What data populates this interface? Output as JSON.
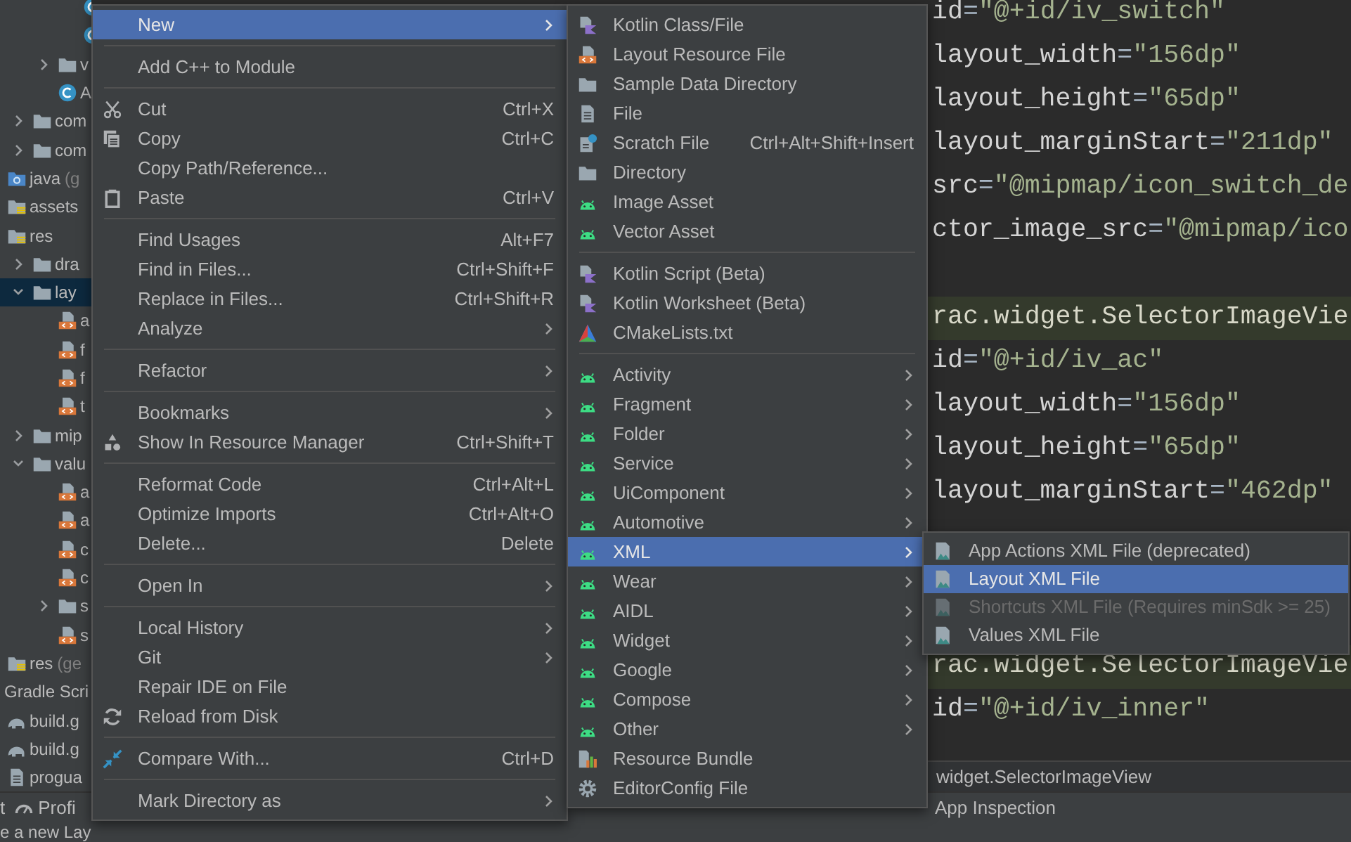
{
  "project_tree": [
    {
      "children": [
        {
          "children": [
            {
              "children": [
                {
                  "children": [
                    {
                      "kind": "class",
                      "selected": false
                    },
                    {
                      "kind": "class",
                      "selected": false
                    }
                  ]
                },
                {
                  "label": "v",
                  "kind": "folder",
                  "expanded": false,
                  "selected": false
                },
                {
                  "label": "A",
                  "kind": "class",
                  "selected": false
                }
              ]
            },
            {
              "label": "com",
              "kind": "folder",
              "expanded": false,
              "selected": false
            },
            {
              "label": "com",
              "kind": "folder",
              "expanded": false,
              "selected": false
            }
          ]
        },
        {
          "label": "java",
          "hint": "(g",
          "kind": "sourceroot",
          "selected": false
        },
        {
          "label": "assets",
          "kind": "resourceroot",
          "selected": false
        },
        {
          "label": "res",
          "kind": "resourceroot",
          "selected": false,
          "children": [
            {
              "label": "dra",
              "kind": "folder",
              "expanded": false,
              "selected": false
            },
            {
              "label": "lay",
              "kind": "folder",
              "expanded": true,
              "selected": true,
              "children": [
                {
                  "label": "a",
                  "kind": "layout",
                  "selected": false
                },
                {
                  "label": "f",
                  "kind": "layout",
                  "selected": false
                },
                {
                  "label": "f",
                  "kind": "layout",
                  "selected": false
                },
                {
                  "label": "t",
                  "kind": "layout",
                  "selected": false
                }
              ]
            },
            {
              "label": "mip",
              "kind": "folder",
              "expanded": false,
              "selected": false
            },
            {
              "label": "valu",
              "kind": "folder",
              "expanded": true,
              "selected": false,
              "children": [
                {
                  "label": "a",
                  "kind": "layout",
                  "selected": false
                },
                {
                  "label": "a",
                  "kind": "layout",
                  "selected": false
                },
                {
                  "label": "c",
                  "kind": "layout",
                  "selected": false
                },
                {
                  "label": "c",
                  "kind": "layout",
                  "selected": false
                },
                {
                  "label": "s",
                  "kind": "folder",
                  "expanded": false,
                  "selected": false
                },
                {
                  "label": "s",
                  "kind": "layout",
                  "selected": false
                }
              ]
            }
          ]
        },
        {
          "label": "res",
          "hint": "(ge",
          "kind": "resourceroot",
          "selected": false
        }
      ]
    },
    {
      "label": "Gradle Scri",
      "kind": "gradle",
      "selected": false,
      "children": [
        {
          "label": "build.g",
          "kind": "gradle",
          "selected": false
        },
        {
          "label": "build.g",
          "kind": "gradle",
          "selected": false
        },
        {
          "label": "progua",
          "kind": "file",
          "selected": false
        }
      ]
    }
  ],
  "code_lines": [
    {
      "kind": "code",
      "highlighted": false,
      "parts": [
        {
          "kind": "name",
          "text": "id"
        },
        {
          "kind": "punct",
          "text": "="
        },
        {
          "kind": "value",
          "text": "\"@+id/iv_switch\""
        }
      ]
    },
    {
      "kind": "code",
      "highlighted": false,
      "parts": [
        {
          "kind": "name",
          "text": "layout_width"
        },
        {
          "kind": "punct",
          "text": "="
        },
        {
          "kind": "value",
          "text": "\"156dp\""
        }
      ]
    },
    {
      "kind": "code",
      "highlighted": false,
      "parts": [
        {
          "kind": "name",
          "text": "layout_height"
        },
        {
          "kind": "punct",
          "text": "="
        },
        {
          "kind": "value",
          "text": "\"65dp\""
        }
      ]
    },
    {
      "kind": "code",
      "highlighted": false,
      "parts": [
        {
          "kind": "name",
          "text": "layout_marginStart"
        },
        {
          "kind": "punct",
          "text": "="
        },
        {
          "kind": "value",
          "text": "\"211dp\""
        }
      ]
    },
    {
      "kind": "code",
      "highlighted": false,
      "parts": [
        {
          "kind": "name",
          "text": "src"
        },
        {
          "kind": "punct",
          "text": "="
        },
        {
          "kind": "value",
          "text": "\"@mipmap/icon_switch_de"
        }
      ]
    },
    {
      "kind": "code",
      "highlighted": false,
      "parts": [
        {
          "kind": "name",
          "text": "ctor_image_src"
        },
        {
          "kind": "punct",
          "text": "="
        },
        {
          "kind": "value",
          "text": "\"@mipmap/ico"
        }
      ]
    },
    {
      "kind": "blank"
    },
    {
      "kind": "code",
      "highlighted": true,
      "parts": [
        {
          "kind": "tag",
          "text": "rac.widget.SelectorImageVie"
        }
      ]
    },
    {
      "kind": "code",
      "highlighted": false,
      "parts": [
        {
          "kind": "name",
          "text": "id"
        },
        {
          "kind": "punct",
          "text": "="
        },
        {
          "kind": "value",
          "text": "\"@+id/iv_ac\""
        }
      ]
    },
    {
      "kind": "code",
      "highlighted": false,
      "parts": [
        {
          "kind": "name",
          "text": "layout_width"
        },
        {
          "kind": "punct",
          "text": "="
        },
        {
          "kind": "value",
          "text": "\"156dp\""
        }
      ]
    },
    {
      "kind": "code",
      "highlighted": false,
      "parts": [
        {
          "kind": "name",
          "text": "layout_height"
        },
        {
          "kind": "punct",
          "text": "="
        },
        {
          "kind": "value",
          "text": "\"65dp\""
        }
      ]
    },
    {
      "kind": "code",
      "highlighted": false,
      "parts": [
        {
          "kind": "name",
          "text": "layout_marginStart"
        },
        {
          "kind": "punct",
          "text": "="
        },
        {
          "kind": "value",
          "text": "\"462dp\""
        }
      ]
    },
    {
      "kind": "blank"
    },
    {
      "kind": "blank"
    },
    {
      "kind": "blank"
    },
    {
      "kind": "code",
      "highlighted": true,
      "parts": [
        {
          "kind": "tag",
          "text": "rac.widget.SelectorImageVie"
        }
      ]
    },
    {
      "kind": "code",
      "highlighted": false,
      "parts": [
        {
          "kind": "name",
          "text": "id"
        },
        {
          "kind": "punct",
          "text": "="
        },
        {
          "kind": "value",
          "text": "\"@+id/iv_inner\""
        }
      ]
    }
  ],
  "breadcrumb": "widget.SelectorImageView",
  "bottom_bar": {
    "left": [
      {
        "label": "t",
        "kind": "plain"
      },
      {
        "label": "Profi",
        "kind": "profiler"
      }
    ],
    "right": [
      {
        "label": "App Inspection"
      }
    ]
  },
  "status_bar": "e a new Lay",
  "context_menu": {
    "items": [
      {
        "kind": "plain",
        "label": "New",
        "selected": true,
        "submenu": true
      },
      {
        "kind": "separator"
      },
      {
        "kind": "plain",
        "label": "Add C++ to Module",
        "selected": false,
        "submenu": false
      },
      {
        "kind": "separator"
      },
      {
        "kind": "scissors",
        "label": "Cut",
        "shortcut": "Ctrl+X",
        "selected": false,
        "submenu": false
      },
      {
        "kind": "copy",
        "label": "Copy",
        "shortcut": "Ctrl+C",
        "selected": false,
        "submenu": false
      },
      {
        "kind": "plain",
        "label": "Copy Path/Reference...",
        "selected": false,
        "submenu": false
      },
      {
        "kind": "paste",
        "label": "Paste",
        "shortcut": "Ctrl+V",
        "selected": false,
        "submenu": false
      },
      {
        "kind": "separator"
      },
      {
        "kind": "plain",
        "label": "Find Usages",
        "shortcut": "Alt+F7",
        "selected": false,
        "submenu": false
      },
      {
        "kind": "plain",
        "label": "Find in Files...",
        "shortcut": "Ctrl+Shift+F",
        "selected": false,
        "submenu": false
      },
      {
        "kind": "plain",
        "label": "Replace in Files...",
        "shortcut": "Ctrl+Shift+R",
        "selected": false,
        "submenu": false
      },
      {
        "kind": "plain",
        "label": "Analyze",
        "selected": false,
        "submenu": true
      },
      {
        "kind": "separator"
      },
      {
        "kind": "plain",
        "label": "Refactor",
        "selected": false,
        "submenu": true
      },
      {
        "kind": "separator"
      },
      {
        "kind": "plain",
        "label": "Bookmarks",
        "selected": false,
        "submenu": true
      },
      {
        "kind": "resources",
        "label": "Show In Resource Manager",
        "shortcut": "Ctrl+Shift+T",
        "selected": false,
        "submenu": false
      },
      {
        "kind": "separator"
      },
      {
        "kind": "plain",
        "label": "Reformat Code",
        "shortcut": "Ctrl+Alt+L",
        "selected": false,
        "submenu": false
      },
      {
        "kind": "plain",
        "label": "Optimize Imports",
        "shortcut": "Ctrl+Alt+O",
        "selected": false,
        "submenu": false
      },
      {
        "kind": "plain",
        "label": "Delete...",
        "shortcut": "Delete",
        "selected": false,
        "submenu": false
      },
      {
        "kind": "separator"
      },
      {
        "kind": "plain",
        "label": "Open In",
        "selected": false,
        "submenu": true
      },
      {
        "kind": "separator"
      },
      {
        "kind": "plain",
        "label": "Local History",
        "selected": false,
        "submenu": true
      },
      {
        "kind": "plain",
        "label": "Git",
        "selected": false,
        "submenu": true
      },
      {
        "kind": "plain",
        "label": "Repair IDE on File",
        "selected": false,
        "submenu": false
      },
      {
        "kind": "reload",
        "label": "Reload from Disk",
        "selected": false,
        "submenu": false
      },
      {
        "kind": "separator"
      },
      {
        "kind": "compare",
        "label": "Compare With...",
        "shortcut": "Ctrl+D",
        "selected": false,
        "submenu": false
      },
      {
        "kind": "separator"
      },
      {
        "kind": "plain",
        "label": "Mark Directory as",
        "selected": false,
        "submenu": true
      }
    ]
  },
  "new_submenu": {
    "items": [
      {
        "kind": "kotlin",
        "label": "Kotlin Class/File",
        "selected": false,
        "submenu": false
      },
      {
        "kind": "layout",
        "label": "Layout Resource File",
        "selected": false,
        "submenu": false
      },
      {
        "kind": "folder",
        "label": "Sample Data Directory",
        "selected": false,
        "submenu": false
      },
      {
        "kind": "file",
        "label": "File",
        "selected": false,
        "submenu": false
      },
      {
        "kind": "scratch",
        "label": "Scratch File",
        "shortcut": "Ctrl+Alt+Shift+Insert",
        "selected": false,
        "submenu": false
      },
      {
        "kind": "folder",
        "label": "Directory",
        "selected": false,
        "submenu": false
      },
      {
        "kind": "android",
        "label": "Image Asset",
        "selected": false,
        "submenu": false
      },
      {
        "kind": "android",
        "label": "Vector Asset",
        "selected": false,
        "submenu": false
      },
      {
        "kind": "separator"
      },
      {
        "kind": "kotlin",
        "label": "Kotlin Script (Beta)",
        "selected": false,
        "submenu": false
      },
      {
        "kind": "kotlin",
        "label": "Kotlin Worksheet (Beta)",
        "selected": false,
        "submenu": false
      },
      {
        "kind": "cmake",
        "label": "CMakeLists.txt",
        "selected": false,
        "submenu": false
      },
      {
        "kind": "separator"
      },
      {
        "kind": "android",
        "label": "Activity",
        "selected": false,
        "submenu": true
      },
      {
        "kind": "android",
        "label": "Fragment",
        "selected": false,
        "submenu": true
      },
      {
        "kind": "android",
        "label": "Folder",
        "selected": false,
        "submenu": true
      },
      {
        "kind": "android",
        "label": "Service",
        "selected": false,
        "submenu": true
      },
      {
        "kind": "android",
        "label": "UiComponent",
        "selected": false,
        "submenu": true
      },
      {
        "kind": "android",
        "label": "Automotive",
        "selected": false,
        "submenu": true
      },
      {
        "kind": "android",
        "label": "XML",
        "selected": true,
        "submenu": true
      },
      {
        "kind": "android",
        "label": "Wear",
        "selected": false,
        "submenu": true
      },
      {
        "kind": "android",
        "label": "AIDL",
        "selected": false,
        "submenu": true
      },
      {
        "kind": "android",
        "label": "Widget",
        "selected": false,
        "submenu": true
      },
      {
        "kind": "android",
        "label": "Google",
        "selected": false,
        "submenu": true
      },
      {
        "kind": "android",
        "label": "Compose",
        "selected": false,
        "submenu": true
      },
      {
        "kind": "android",
        "label": "Other",
        "selected": false,
        "submenu": true
      },
      {
        "kind": "bundle",
        "label": "Resource Bundle",
        "selected": false,
        "submenu": false
      },
      {
        "kind": "gear",
        "label": "EditorConfig File",
        "selected": false,
        "submenu": false
      }
    ]
  },
  "xml_submenu": {
    "items": [
      {
        "kind": "xmlfile",
        "label": "App Actions XML File (deprecated)",
        "selected": false,
        "disabled": false
      },
      {
        "kind": "xmlfile",
        "label": "Layout XML File",
        "selected": true,
        "disabled": false
      },
      {
        "kind": "xmlfile",
        "label": "Shortcuts XML File (Requires minSdk >= 25)",
        "selected": false,
        "disabled": true
      },
      {
        "kind": "xmlfile",
        "label": "Values XML File",
        "selected": false,
        "disabled": false
      }
    ]
  }
}
